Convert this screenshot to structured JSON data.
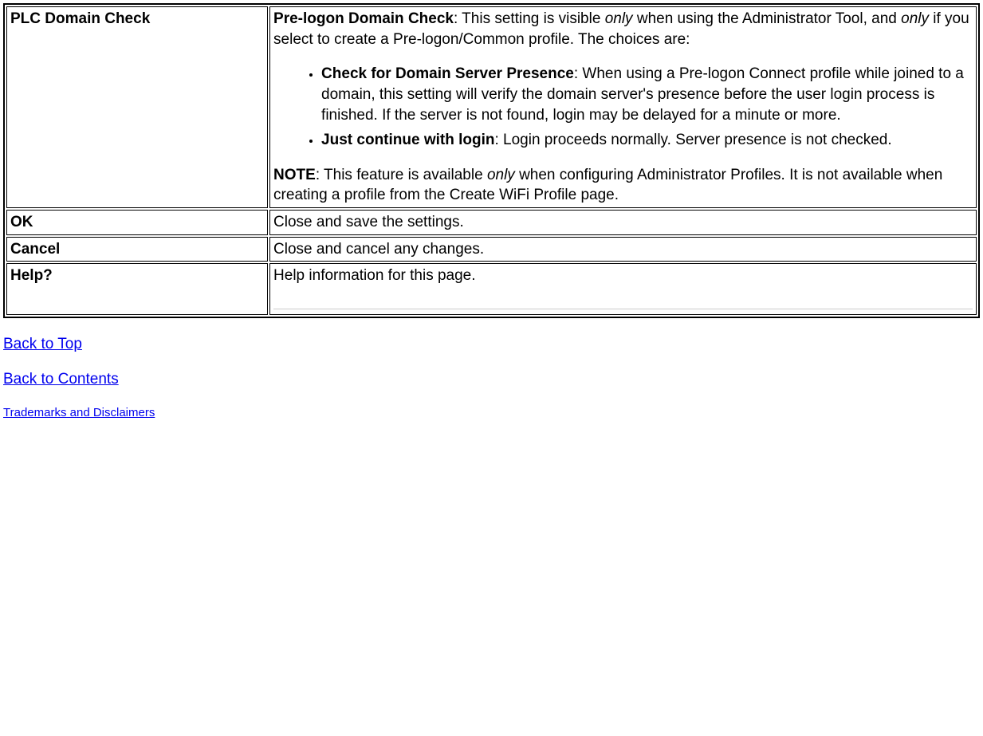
{
  "table": {
    "plc": {
      "label": "PLC Domain Check",
      "desc_head_bold": "Pre-logon Domain Check",
      "desc_head_pre": ": This setting is visible ",
      "only1": "only",
      "desc_head_mid": " when using the Administrator Tool, and ",
      "only2": "only",
      "desc_head_post": " if you select to create a Pre-logon/Common profile. The choices are:",
      "item1_bold": "Check for Domain Server Presence",
      "item1_rest": ": When using a Pre-logon Connect profile while joined to a domain, this setting will verify the domain server's presence before the user login process is finished. If the server is not found, login may be delayed for a minute or more.",
      "item2_bold": "Just continue with login",
      "item2_rest": ": Login proceeds normally. Server presence is not checked.",
      "note_bold": "NOTE",
      "note_pre": ": This feature is available ",
      "note_only": "only",
      "note_post": " when configuring Administrator Profiles. It is not available when creating a profile from the Create WiFi Profile page."
    },
    "ok": {
      "label": "OK",
      "desc": "Close and save the settings."
    },
    "cancel": {
      "label": "Cancel",
      "desc": "Close and cancel any changes."
    },
    "help": {
      "label": "Help?",
      "desc": "Help information for this page."
    }
  },
  "links": {
    "back_top": "Back to Top",
    "back_contents": "Back to Contents",
    "trademarks": "Trademarks and Disclaimers"
  }
}
